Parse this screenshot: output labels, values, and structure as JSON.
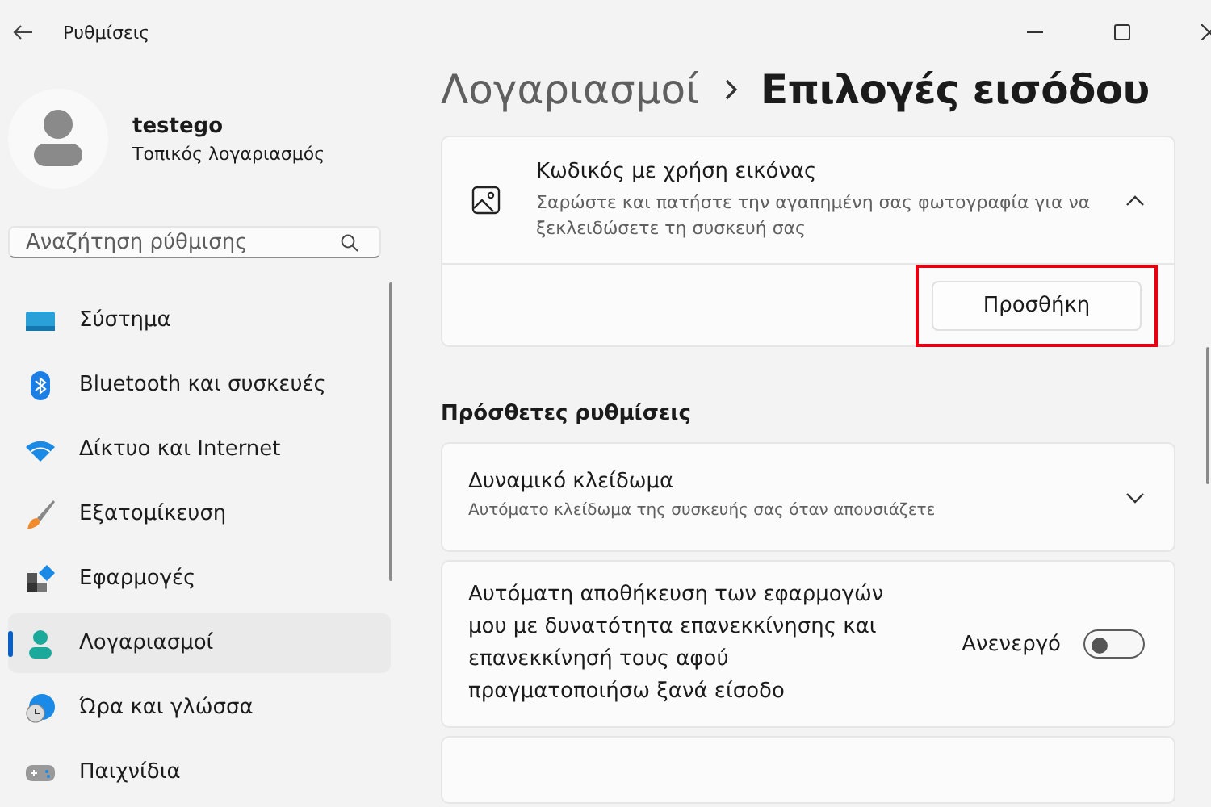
{
  "window": {
    "title": "Ρυθμίσεις"
  },
  "profile": {
    "name": "testego",
    "account_type": "Τοπικός λογαριασμός"
  },
  "search": {
    "placeholder": "Αναζήτηση ρύθμισης"
  },
  "sidebar": {
    "items": [
      {
        "label": "Σύστημα",
        "kind": "system",
        "selected": false
      },
      {
        "label": "Bluetooth και συσκευές",
        "kind": "bluetooth",
        "selected": false
      },
      {
        "label": "Δίκτυο και Internet",
        "kind": "network",
        "selected": false
      },
      {
        "label": "Εξατομίκευση",
        "kind": "brush",
        "selected": false
      },
      {
        "label": "Εφαρμογές",
        "kind": "apps",
        "selected": false
      },
      {
        "label": "Λογαριασμοί",
        "kind": "accounts",
        "selected": true
      },
      {
        "label": "Ώρα και γλώσσα",
        "kind": "time",
        "selected": false
      },
      {
        "label": "Παιχνίδια",
        "kind": "gaming",
        "selected": false
      }
    ]
  },
  "breadcrumb": {
    "parent": "Λογαριασμοί",
    "current": "Επιλογές εισόδου"
  },
  "picture_password": {
    "title": "Κωδικός με χρήση εικόνας",
    "description": "Σαρώστε και πατήστε την αγαπημένη σας φωτογραφία για να ξεκλειδώσετε τη συσκευή σας",
    "expanded": true,
    "button": {
      "label": "Προσθήκη",
      "highlighted": true
    }
  },
  "additional": {
    "heading": "Πρόσθετες ρυθμίσεις",
    "items": [
      {
        "kind": "expander",
        "title": "Δυναμικό κλείδωμα",
        "description": "Αυτόματο κλείδωμα της συσκευής σας όταν απουσιάζετε",
        "expanded": false
      },
      {
        "kind": "toggle",
        "title": "Αυτόματη αποθήκευση των εφαρμογών μου με δυνατότητα επανεκκίνησης και επανεκκίνησή τους αφού πραγματοποιήσω ξανά είσοδο",
        "state_label": "Ανενεργό",
        "on": false
      },
      {
        "kind": "blank"
      }
    ]
  }
}
